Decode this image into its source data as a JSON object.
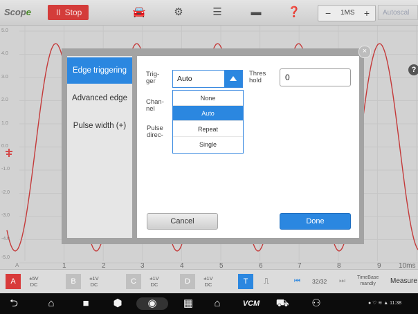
{
  "toolbar": {
    "logo_main": "Scop",
    "logo_tail": "e",
    "stop_label": "Stop",
    "pause_glyph": "II",
    "timebase_value": "1MS",
    "timebase_minus": "−",
    "timebase_plus": "+",
    "autoscale_label": "Autoscal",
    "icons": [
      "car-icon",
      "gear-icon",
      "database-icon",
      "folder-icon",
      "help-icon"
    ]
  },
  "plot": {
    "y_labels": [
      "5.0",
      "4.0",
      "3.0",
      "2.0",
      "1.0",
      "0.0",
      "-1.0",
      "-2.0",
      "-3.0",
      "-4.0",
      "-5.0"
    ],
    "x_labels": [
      "1",
      "2",
      "3",
      "4",
      "5",
      "6",
      "7",
      "8",
      "9",
      "10ms"
    ],
    "x_start_label": "A",
    "help_glyph": "?",
    "waveform_color": "#c43a3a",
    "trigger_marker_color": "#d44a4a"
  },
  "dialog": {
    "close_glyph": "×",
    "tabs": [
      {
        "label": "Edge triggering",
        "active": true
      },
      {
        "label": "Advanced edge",
        "active": false
      },
      {
        "label": "Pulse width (+)",
        "active": false
      }
    ],
    "trigger_label_1": "Trig-",
    "trigger_label_2": "ger",
    "channel_label_1": "Chan-",
    "channel_label_2": "nel",
    "pulse_label_1": "Pulse",
    "pulse_label_2": "direc-",
    "threshold_label_1": "Thres",
    "threshold_label_2": "hold",
    "trigger_value": "Auto",
    "trigger_options": [
      {
        "label": "None",
        "selected": false
      },
      {
        "label": "Auto",
        "selected": true
      },
      {
        "label": "Repeat",
        "selected": false
      },
      {
        "label": "Single",
        "selected": false
      }
    ],
    "threshold_value": "0",
    "cancel_label": "Cancel",
    "done_label": "Done"
  },
  "channels": [
    {
      "letter": "A",
      "color": "#d83a3a",
      "range": "±5V",
      "coupling": "DC"
    },
    {
      "letter": "B",
      "color": "#c0c0c0",
      "range": "±1V",
      "coupling": "DC"
    },
    {
      "letter": "C",
      "color": "#c0c0c0",
      "range": "±1V",
      "coupling": "DC"
    },
    {
      "letter": "D",
      "color": "#c0c0c0",
      "range": "±1V",
      "coupling": "DC"
    }
  ],
  "statusbar": {
    "trigger_button": "T",
    "edge_glyph": "⎍",
    "page_counter": "32/32",
    "timebase_mode_1": "TimeBase",
    "timebase_mode_2": "mandly",
    "measure_label": "Measure"
  },
  "navbar": {
    "status_text": "11:38",
    "vcm_label": "VCM"
  }
}
